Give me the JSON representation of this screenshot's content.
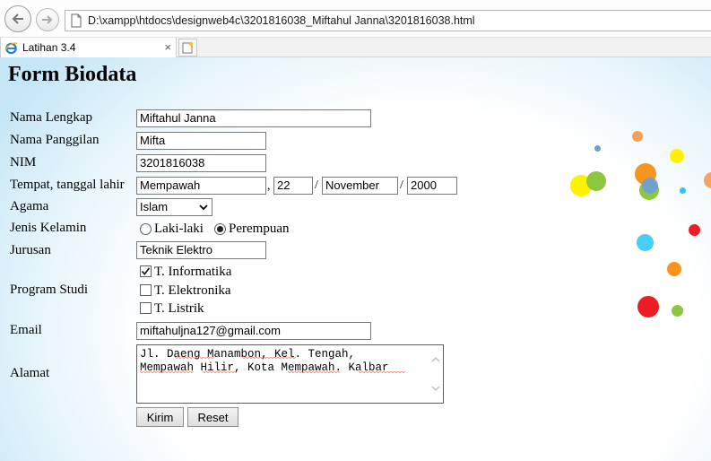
{
  "browser": {
    "address": "D:\\xampp\\htdocs\\designweb4c\\3201816038_Miftahul Janna\\3201816038.html",
    "tab_title": "Latihan 3.4",
    "tab_close": "×"
  },
  "form": {
    "title": "Form Biodata",
    "labels": {
      "nama_lengkap": "Nama Lengkap",
      "nama_panggilan": "Nama Panggilan",
      "nim": "NIM",
      "ttl": "Tempat, tanggal lahir",
      "agama": "Agama",
      "jenis_kelamin": "Jenis Kelamin",
      "jurusan": "Jurusan",
      "program_studi": "Program Studi",
      "email": "Email",
      "alamat": "Alamat"
    },
    "values": {
      "nama_lengkap": "Miftahul Janna",
      "nama_panggilan": "Mifta",
      "nim": "3201816038",
      "tempat": "Mempawah",
      "tanggal": "22",
      "bulan": "November",
      "tahun": "2000",
      "agama": "Islam",
      "jurusan": "Teknik Elektro",
      "email": "miftahuljna127@gmail.com",
      "alamat_line1": "Jl. Daeng Manambon, Kel. Tengah,",
      "alamat_line2": "Mempawah Hilir, Kota Mempawah. Kalbar"
    },
    "separators": {
      "comma": ",",
      "slash": "/"
    },
    "gender_options": [
      {
        "label": "Laki-laki",
        "checked": false
      },
      {
        "label": "Perempuan",
        "checked": true
      }
    ],
    "program_options": [
      {
        "label": "T. Informatika",
        "checked": true
      },
      {
        "label": "T. Elektronika",
        "checked": false
      },
      {
        "label": "T. Listrik",
        "checked": false
      }
    ],
    "buttons": {
      "submit": "Kirim",
      "reset": "Reset"
    }
  },
  "decor_colors": [
    "#f7941d",
    "#8dc63f",
    "#fff200",
    "#29c5f6",
    "#ed1c24",
    "#6c9fd8",
    "#f58220"
  ]
}
